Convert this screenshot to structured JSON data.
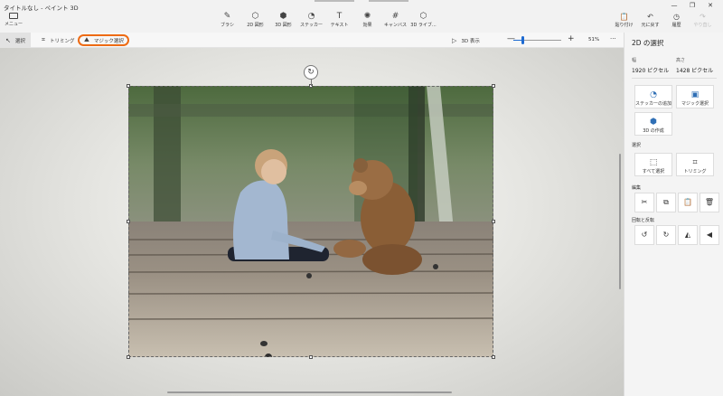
{
  "window": {
    "title": "タイトルなし - ペイント 3D"
  },
  "menu": {
    "label": "メニュー"
  },
  "toolbar": {
    "tools": [
      {
        "icon": "brush-icon",
        "glyph": "✎",
        "label": "ブラシ"
      },
      {
        "icon": "shapes-2d-icon",
        "glyph": "⬡",
        "label": "2D 図形"
      },
      {
        "icon": "shapes-3d-icon",
        "glyph": "⬢",
        "label": "3D 図形"
      },
      {
        "icon": "sticker-icon",
        "glyph": "◔",
        "label": "ステッカー"
      },
      {
        "icon": "text-icon",
        "glyph": "T",
        "label": "テキスト"
      },
      {
        "icon": "effects-icon",
        "glyph": "✺",
        "label": "効果"
      },
      {
        "icon": "canvas-icon",
        "glyph": "#",
        "label": "キャンバス"
      },
      {
        "icon": "library-3d-icon",
        "glyph": "⬡",
        "label": "3D ライブ..."
      }
    ],
    "actions": [
      {
        "icon": "paste-icon",
        "glyph": "📋",
        "label": "貼り付け",
        "disabled": false
      },
      {
        "icon": "undo-icon",
        "glyph": "↶",
        "label": "元に戻す",
        "disabled": false
      },
      {
        "icon": "history-icon",
        "glyph": "◷",
        "label": "履歴",
        "disabled": false
      },
      {
        "icon": "redo-icon",
        "glyph": "↷",
        "label": "やり直し",
        "disabled": true
      }
    ],
    "window_controls": [
      "—",
      "❐",
      "✕"
    ]
  },
  "subtoolbar": {
    "select_label": "選択",
    "trim_label": "トリミング",
    "magic_select_label": "マジック選択",
    "view3d_label": "3D 表示",
    "zoom_minus": "—",
    "zoom_plus": "+",
    "zoom_percent": "51%",
    "zoom_level": 0.19,
    "more": "···"
  },
  "panel": {
    "title": "2D の選択",
    "width_label": "幅",
    "width_value": "1920 ピクセル",
    "height_label": "高さ",
    "height_value": "1428 ピクセル",
    "add_sticker_label": "ステッカーの追加",
    "magic_select_label": "マジック選択",
    "make_3d_label": "3D の作成",
    "select_section": "選択",
    "select_all_label": "すべて選択",
    "trim_label": "トリミング",
    "edit_section": "編集",
    "edit_icons": [
      "cut-icon",
      "copy-icon",
      "paste-icon",
      "delete-icon"
    ],
    "edit_glyphs": [
      "✂",
      "⧉",
      "📋",
      "🗑"
    ],
    "rotate_section": "回転と反転",
    "rotate_icons": [
      "rotate-left-icon",
      "rotate-right-icon",
      "flip-vertical-icon",
      "flip-horizontal-icon"
    ],
    "rotate_glyphs": [
      "↺",
      "↻",
      "◭",
      "◀"
    ]
  },
  "colors": {
    "accent": "#1e6ad1",
    "highlight": "#ee6b14",
    "panel_icon": "#2f6fb5"
  }
}
